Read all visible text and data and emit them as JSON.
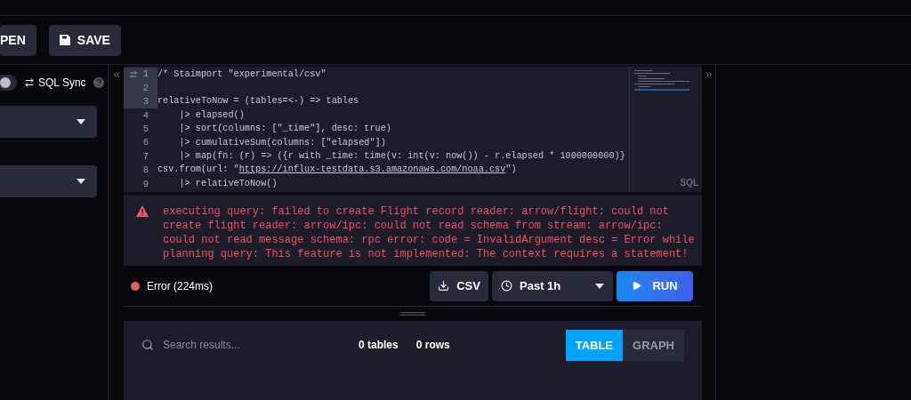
{
  "toolbar": {
    "buttons": [
      {
        "label": "PEN",
        "kind": "open"
      },
      {
        "label": "SAVE",
        "kind": "save"
      }
    ]
  },
  "sidebar": {
    "sql_sync": {
      "label": "SQL Sync",
      "on": false
    },
    "dropdowns": [
      {
        "kind": "select"
      },
      {
        "kind": "select"
      }
    ]
  },
  "editor": {
    "lines": [
      {
        "number": "1",
        "selected": true,
        "segments": [
          {
            "text": "/* Staimport \"experimental/csv\""
          }
        ]
      },
      {
        "number": "2",
        "selected": true
      },
      {
        "number": "3",
        "selected": true,
        "segments": [
          {
            "text": "relativeToNow = (tables=<-) => tables"
          }
        ]
      },
      {
        "number": "4",
        "selected": false,
        "segments": [
          {
            "text": "    |> elapsed()"
          }
        ]
      },
      {
        "number": "5",
        "selected": false,
        "segments": [
          {
            "text": "    |> sort(columns: [\"_time\"], desc: true)"
          }
        ]
      },
      {
        "number": "6",
        "selected": false,
        "segments": [
          {
            "text": "    |> cumulativeSum(columns: [\"elapsed\"])"
          }
        ]
      },
      {
        "number": "7",
        "selected": false,
        "segments": [
          {
            "text": "    |> map(fn: (r) => ({r with _time: time(v: int(v: now()) - r.elapsed * 1000000000)}"
          }
        ]
      },
      {
        "number": "8",
        "selected": false,
        "segments": [
          {
            "text": "csv.from(url: \""
          },
          {
            "text": "https://influx-testdata.s3.amazonaws.com/noaa.csv",
            "kind": "link"
          },
          {
            "text": "\")"
          }
        ]
      },
      {
        "number": "9",
        "selected": false,
        "segments": [
          {
            "text": "    |> relativeToNow()"
          }
        ]
      }
    ],
    "language": "SQL"
  },
  "error": {
    "message": "executing query: failed to create Flight record reader: arrow/flight: could not create flight reader: arrow/ipc: could not read schema from stream: arrow/ipc: could not read message schema: rpc error: code = InvalidArgument desc = Error while planning query: This feature is not implemented: The context requires a statement!"
  },
  "status": {
    "text": "Error (224ms)",
    "color": "#e85b6a"
  },
  "actions": {
    "csv": "CSV",
    "time_range": "Past 1h",
    "run": "RUN"
  },
  "results": {
    "search": {
      "placeholder": "Search results..."
    },
    "tables": "0 tables",
    "rows": "0 rows",
    "views": [
      {
        "label": "TABLE",
        "selected": true
      },
      {
        "label": "GRAPH",
        "selected": false
      }
    ]
  }
}
